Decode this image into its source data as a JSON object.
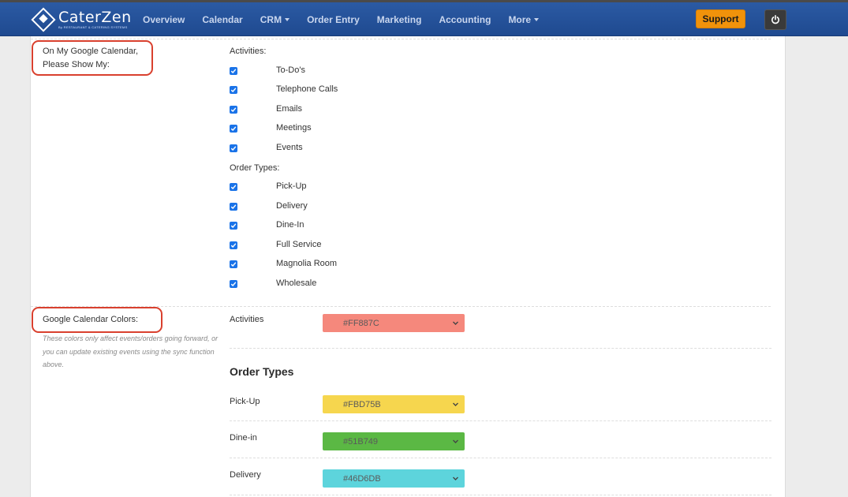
{
  "nav": {
    "brand": "CaterZen",
    "brand_sub": "By RESTAURANT & CATERING SYSTEMS",
    "items": [
      "Overview",
      "Calendar",
      "CRM",
      "Order Entry",
      "Marketing",
      "Accounting",
      "More"
    ],
    "support": "Support"
  },
  "show": {
    "label_line1": "On My Google Calendar,",
    "label_line2": "Please Show My:",
    "activities_header": "Activities:",
    "activities": [
      "To-Do's",
      "Telephone Calls",
      "Emails",
      "Meetings",
      "Events"
    ],
    "order_types_header": "Order Types:",
    "order_types": [
      "Pick-Up",
      "Delivery",
      "Dine-In",
      "Full Service",
      "Magnolia Room",
      "Wholesale"
    ]
  },
  "colors": {
    "label": "Google Calendar Colors:",
    "note": "These colors only affect events/orders going forward, or you can update existing events using the sync function above.",
    "activities_label": "Activities",
    "activities_color": "#FF887C",
    "order_types_heading": "Order Types",
    "order_types": [
      {
        "label": "Pick-Up",
        "color": "#FBD75B"
      },
      {
        "label": "Dine-in",
        "color": "#51B749"
      },
      {
        "label": "Delivery",
        "color": "#46D6DB"
      }
    ]
  },
  "theme": {
    "nav_color": "#2356a0",
    "support_color": "#F0920B",
    "checkbox_color": "#1A73E8",
    "highlight_circle": "#D9402E"
  }
}
